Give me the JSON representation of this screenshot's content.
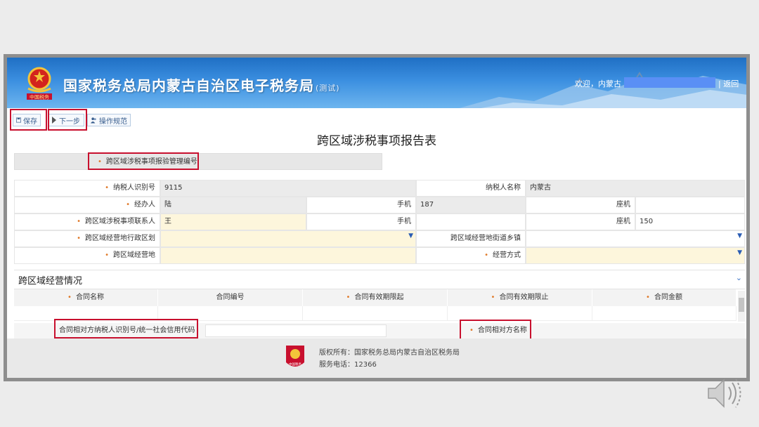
{
  "header": {
    "site_title": "国家税务总局内蒙古自治区电子税务局",
    "site_subtitle": "(测试)",
    "logo_text": "中国税务",
    "welcome": "欢迎，内蒙古",
    "return_link": "返回"
  },
  "toolbar": {
    "save_label": "保存",
    "next_label": "下一步",
    "guide_label": "操作规范"
  },
  "form": {
    "title": "跨区域涉税事项报告表",
    "report_no_label": "跨区域涉税事项报验管理编号",
    "taxpayer_id_label": "纳税人识别号",
    "taxpayer_id_value": "9115",
    "taxpayer_name_label": "纳税人名称",
    "taxpayer_name_value": "内蒙古",
    "handler_label": "经办人",
    "handler_value": "陆",
    "mobile_label": "手机",
    "handler_mobile_value": "187",
    "landline_label": "座机",
    "contact_label": "跨区域涉税事项联系人",
    "contact_value": "王",
    "contact_landline_value": "150",
    "region_label": "跨区域经营地行政区划",
    "street_label": "跨区域经营地街道乡镇",
    "place_label": "跨区域经营地",
    "mode_label": "经营方式"
  },
  "section": {
    "title": "跨区域经营情况"
  },
  "contracts": {
    "columns": [
      "合同名称",
      "合同编号",
      "合同有效期限起",
      "合同有效期限止",
      "合同金额"
    ],
    "required": [
      true,
      false,
      true,
      true,
      true
    ]
  },
  "party": {
    "id_label": "合同相对方纳税人识别号/统一社会信用代码",
    "name_label": "合同相对方名称"
  },
  "footer": {
    "badge_text": "中国税务",
    "copyright": "版权所有：国家税务总局内蒙古自治区税务局",
    "hotline": "服务电话：12366"
  }
}
